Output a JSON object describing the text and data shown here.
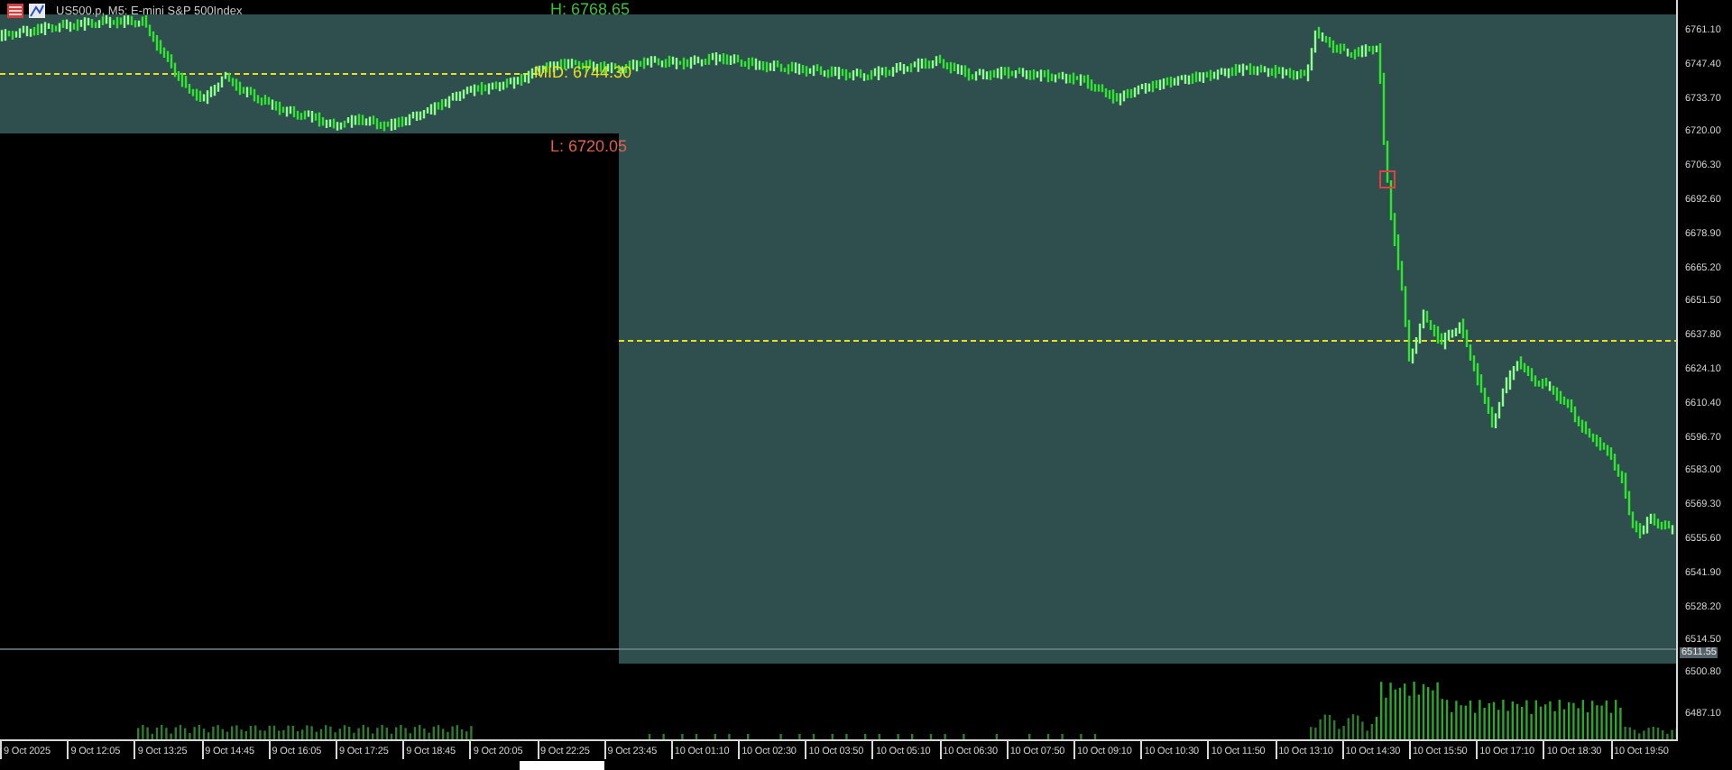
{
  "chart": {
    "title": "US500.p, M5:  E-mini S&P 500Index",
    "high_label": "H: 6768.65",
    "mid_label": "MID: 6744.30",
    "low_label": "L: 6720.05",
    "current_price": "6511.55",
    "price_axis": [
      "6761.10",
      "6747.40",
      "6733.70",
      "6720.00",
      "6706.30",
      "6692.60",
      "6678.90",
      "6665.20",
      "6651.50",
      "6637.80",
      "6624.10",
      "6610.40",
      "6596.70",
      "6583.00",
      "6569.30",
      "6555.60",
      "6541.90",
      "6528.20",
      "6514.50"
    ],
    "volume_axis": [
      "6500.80",
      "6487.10"
    ],
    "time_axis": [
      "9 Oct 2025",
      "9 Oct 12:05",
      "9 Oct 13:25",
      "9 Oct 14:45",
      "9 Oct 16:05",
      "9 Oct 17:25",
      "9 Oct 18:45",
      "9 Oct 20:05",
      "9 Oct 22:25",
      "9 Oct 23:45",
      "10 Oct 01:10",
      "10 Oct 02:30",
      "10 Oct 03:50",
      "10 Oct 05:10",
      "10 Oct 06:30",
      "10 Oct 07:50",
      "10 Oct 09:10",
      "10 Oct 10:30",
      "10 Oct 11:50",
      "10 Oct 13:10",
      "10 Oct 14:30",
      "10 Oct 15:50",
      "10 Oct 17:10",
      "10 Oct 18:30",
      "10 Oct 19:50"
    ]
  }
}
